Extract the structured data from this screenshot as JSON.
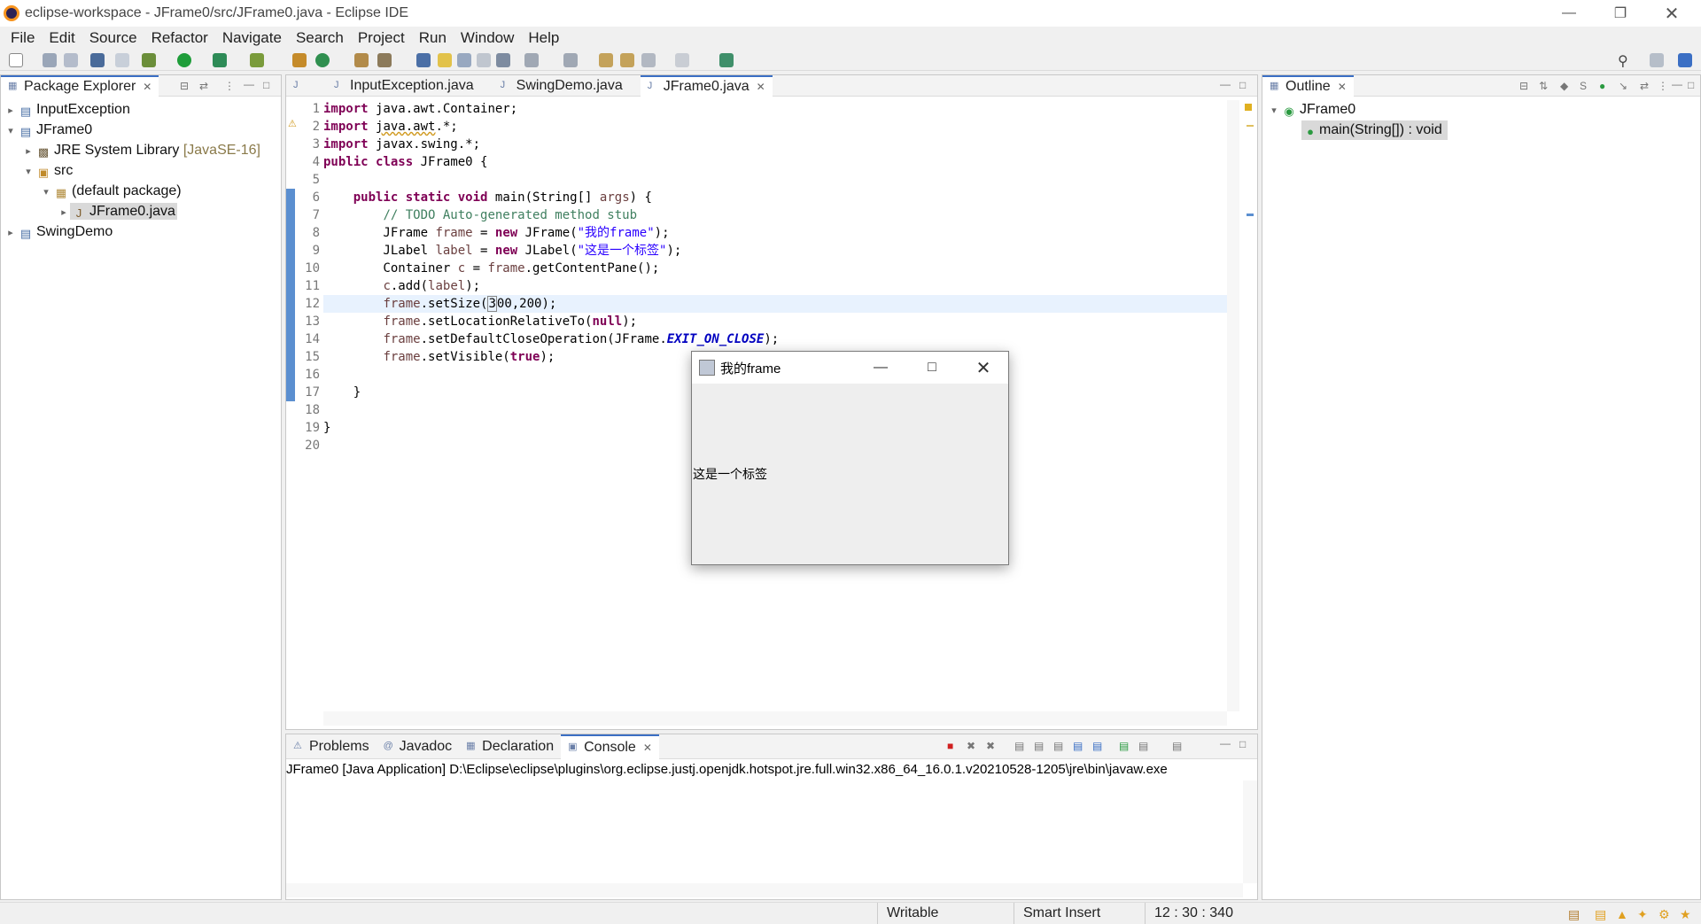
{
  "window": {
    "title": "eclipse-workspace - JFrame0/src/JFrame0.java - Eclipse IDE"
  },
  "menu": [
    "File",
    "Edit",
    "Source",
    "Refactor",
    "Navigate",
    "Search",
    "Project",
    "Run",
    "Window",
    "Help"
  ],
  "package_explorer": {
    "tab": "Package Explorer",
    "items": [
      {
        "label": "InputException",
        "depth": 0,
        "expanded": false,
        "icon": "project-icon"
      },
      {
        "label": "JFrame0",
        "depth": 0,
        "expanded": true,
        "icon": "project-icon"
      },
      {
        "label": "JRE System Library",
        "extra": "[JavaSE-16]",
        "depth": 1,
        "expanded": false,
        "icon": "library-icon"
      },
      {
        "label": "src",
        "depth": 1,
        "expanded": true,
        "icon": "source-folder-icon"
      },
      {
        "label": "(default package)",
        "depth": 2,
        "expanded": true,
        "icon": "package-icon"
      },
      {
        "label": "JFrame0.java",
        "depth": 3,
        "expanded": false,
        "icon": "java-file-icon",
        "selected": true
      },
      {
        "label": "SwingDemo",
        "depth": 0,
        "expanded": false,
        "icon": "project-icon"
      }
    ]
  },
  "editor": {
    "tabs": [
      {
        "label": "InputException.java",
        "active": false
      },
      {
        "label": "SwingDemo.java",
        "active": false
      },
      {
        "label": "JFrame0.java",
        "active": true
      }
    ],
    "line_numbers": [
      "1",
      "2",
      "3",
      "4",
      "5",
      "6",
      "7",
      "8",
      "9",
      "10",
      "11",
      "12",
      "13",
      "14",
      "15",
      "16",
      "17",
      "18",
      "19",
      "20"
    ],
    "current_line": 12
  },
  "outline": {
    "tab": "Outline",
    "class_name": "JFrame0",
    "method": "main(String[]) : void"
  },
  "bottom": {
    "tabs": [
      "Problems",
      "Javadoc",
      "Declaration",
      "Console"
    ],
    "active_tab": "Console",
    "console_header": "JFrame0 [Java Application] D:\\Eclipse\\eclipse\\plugins\\org.eclipse.justj.openjdk.hotspot.jre.full.win32.x86_64_16.0.1.v20210528-1205\\jre\\bin\\javaw.exe"
  },
  "status": {
    "mode": "Writable",
    "insert": "Smart Insert",
    "position": "12 : 30 : 340"
  },
  "swing_frame": {
    "title": "我的frame",
    "label": "这是一个标签"
  }
}
